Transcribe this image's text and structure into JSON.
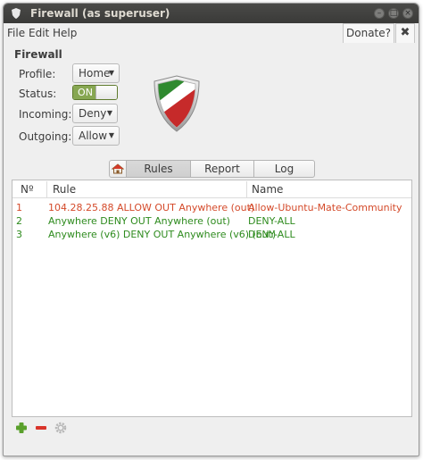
{
  "window": {
    "title": "Firewall (as superuser)",
    "controls": {
      "minimize": "–",
      "maximize": "□",
      "close": "×"
    }
  },
  "menubar": {
    "items": [
      "File",
      "Edit",
      "Help"
    ],
    "donate_label": "Donate?",
    "donate_close": "✖"
  },
  "section": {
    "title": "Firewall"
  },
  "settings": {
    "profile": {
      "label": "Profile:",
      "value": "Home"
    },
    "status": {
      "label": "Status:",
      "value": "ON"
    },
    "incoming": {
      "label": "Incoming:",
      "value": "Deny"
    },
    "outgoing": {
      "label": "Outgoing:",
      "value": "Allow"
    }
  },
  "tabs": {
    "home_icon": "home-icon",
    "items": [
      "Rules",
      "Report",
      "Log"
    ],
    "active": "Rules"
  },
  "rules": {
    "columns": {
      "num": "Nº",
      "rule": "Rule",
      "name": "Name"
    },
    "rows": [
      {
        "num": "1",
        "rule": "104.28.25.88 ALLOW OUT Anywhere (out)",
        "name": "Allow-Ubuntu-Mate-Community",
        "color": "#d44a2a"
      },
      {
        "num": "2",
        "rule": "Anywhere DENY OUT Anywhere (out)",
        "name": "DENY-ALL",
        "color": "#2e8b1e"
      },
      {
        "num": "3",
        "rule": "Anywhere (v6) DENY OUT Anywhere (v6) (out)",
        "name": "DENY-ALL",
        "color": "#2e8b1e"
      }
    ]
  },
  "toolbar": {
    "add_icon": "plus-icon",
    "remove_icon": "minus-icon",
    "settings_icon": "gear-icon"
  },
  "colors": {
    "accent_green": "#87a752",
    "allow_red": "#d44a2a",
    "deny_green": "#2e8b1e"
  }
}
